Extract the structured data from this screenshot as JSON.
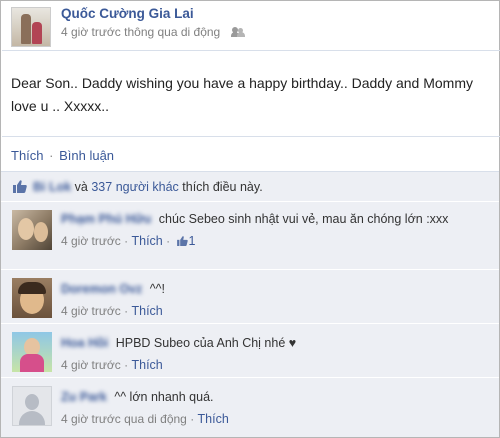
{
  "post": {
    "author": "Quốc Cường Gia Lai",
    "time": "4 giờ trước",
    "via": "thông qua di động",
    "message": "Dear Son.. Daddy wishing you have a happy birthday.. Daddy and Mommy love u .. Xxxxx..",
    "actions": {
      "like": "Thích",
      "separator": "·",
      "comment": "Bình luận"
    }
  },
  "likes": {
    "name": "Bi Lok",
    "conj": " và ",
    "others": "337 người khác",
    "suffix": " thích điều này."
  },
  "comments": [
    {
      "name": "Phạm Phú Hữu",
      "text": "chúc Sebeo sinh nhật vui vẻ, mau ăn chóng lớn :xxx",
      "time": "4 giờ trước",
      "sep": "·",
      "like": "Thích",
      "sep2": "·",
      "like_count": "1"
    },
    {
      "name": "Doremon Ovz",
      "text": "^^!",
      "time": "4 giờ trước",
      "sep": "·",
      "like": "Thích"
    },
    {
      "name": "Hoa Hồi",
      "text": "HPBD Subeo của Anh Chị nhé ♥",
      "time": "4 giờ trước",
      "sep": "·",
      "like": "Thích"
    },
    {
      "name": "Zu Park",
      "text": "^^ lớn nhanh quá.",
      "time": "4 giờ trước qua di động",
      "sep": "·",
      "like": "Thích"
    }
  ],
  "colors": {
    "link": "#3b5998",
    "ufi_bg": "#edeff4",
    "meta": "#808080"
  }
}
